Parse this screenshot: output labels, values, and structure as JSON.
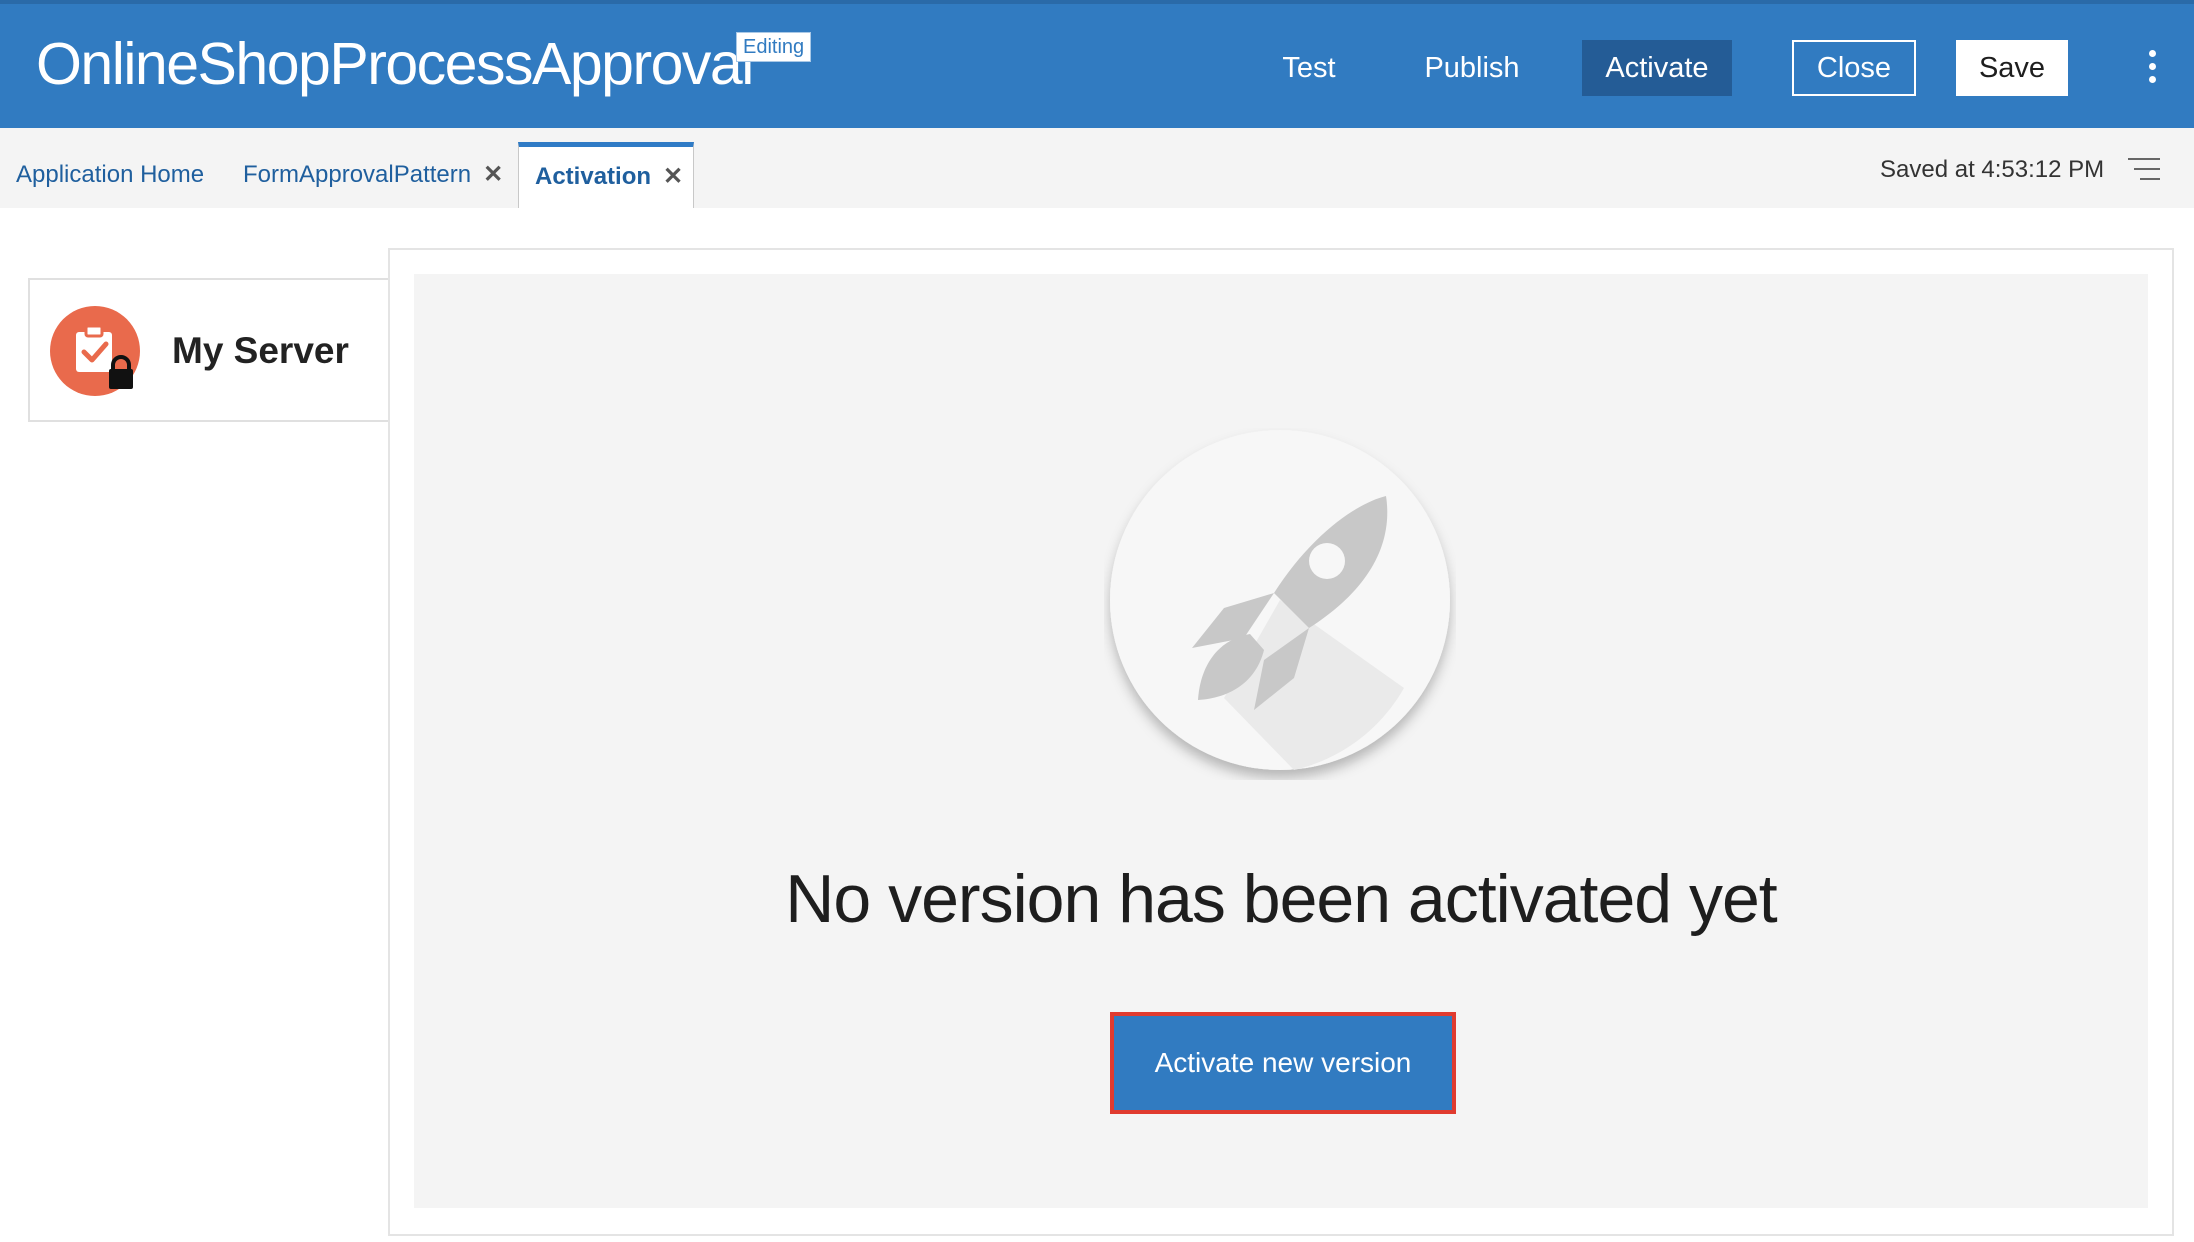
{
  "header": {
    "app_title": "OnlineShopProcessApproval",
    "status_badge": "Editing",
    "buttons": {
      "test": "Test",
      "publish": "Publish",
      "activate": "Activate",
      "close": "Close",
      "save": "Save"
    },
    "menu_icon": "kebab-menu-icon"
  },
  "tabs": [
    {
      "label": "Application Home",
      "closable": false,
      "active": false
    },
    {
      "label": "FormApprovalPattern",
      "closable": true,
      "active": false
    },
    {
      "label": "Activation",
      "closable": true,
      "active": true
    }
  ],
  "tab_close_glyph": "✕",
  "status": {
    "saved_text": "Saved at 4:53:12 PM",
    "list_icon": "list-menu-icon"
  },
  "server": {
    "name": "My Server",
    "icon": "clipboard-check-lock-icon",
    "icon_color": "#e96a4c"
  },
  "main": {
    "illustration": "rocket-icon",
    "empty_message": "No version has been activated yet",
    "activate_button": "Activate new version"
  },
  "colors": {
    "header_bg": "#317bc1",
    "accent": "#317bc1",
    "highlight_border": "#e03b2f"
  }
}
